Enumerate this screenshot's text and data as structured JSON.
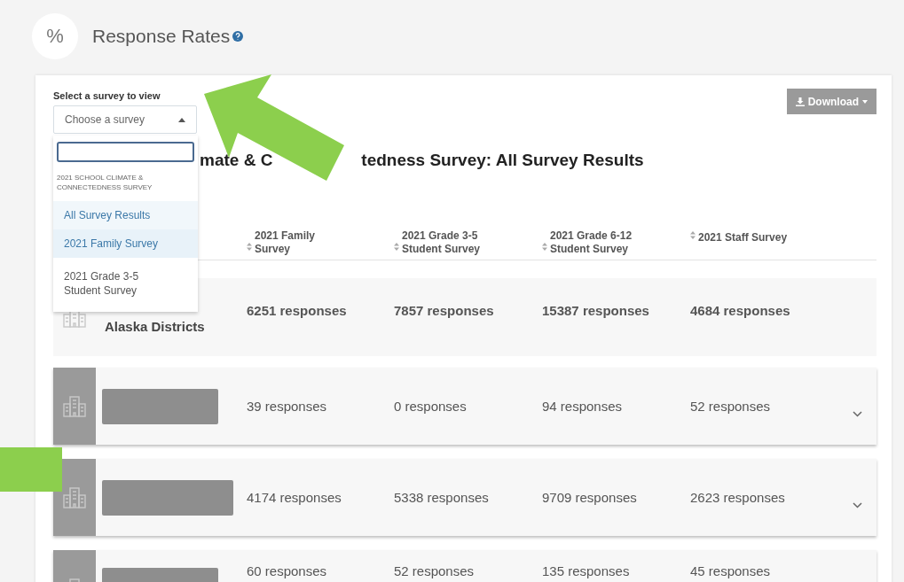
{
  "header": {
    "icon": "%",
    "title": "Response Rates"
  },
  "survey_select": {
    "label": "Select a survey to view",
    "value": "Choose a survey",
    "expanded": true
  },
  "dropdown": {
    "heading": "2021 SCHOOL CLIMATE & CONNECTEDNESS SURVEY",
    "options": [
      {
        "label": "All Survey Results",
        "selected": true,
        "highlighted": false
      },
      {
        "label": "2021 Family Survey",
        "selected": false,
        "highlighted": true
      },
      {
        "label": "2021 Grade 3-5 Student Survey",
        "selected": false,
        "highlighted": false
      }
    ]
  },
  "download_button": "Download",
  "title_fragments": [
    "mate & C",
    "tedness Survey: All Survey Results"
  ],
  "columns": [
    {
      "lines": [
        "2021 Family",
        "Survey"
      ]
    },
    {
      "lines": [
        "2021 Grade 3-5",
        "Student Survey"
      ]
    },
    {
      "lines": [
        "2021 Grade 6-12",
        "Student Survey"
      ]
    },
    {
      "lines": [
        "2021 Staff Survey"
      ]
    }
  ],
  "rows": [
    {
      "kind": "total",
      "name": "Alaska Districts",
      "cells": [
        "6251 responses",
        "7857 responses",
        "15387 responses",
        "4684 responses"
      ],
      "expandable": false
    },
    {
      "kind": "redacted",
      "cells": [
        "39 responses",
        "0 responses",
        "94 responses",
        "52 responses"
      ],
      "expandable": true
    },
    {
      "kind": "redacted",
      "cells": [
        "4174 responses",
        "5338 responses",
        "9709 responses",
        "2623 responses"
      ],
      "expandable": true
    },
    {
      "kind": "redacted",
      "cells": [
        "60 responses",
        "52 responses",
        "135 responses",
        "45 responses"
      ]
    }
  ]
}
